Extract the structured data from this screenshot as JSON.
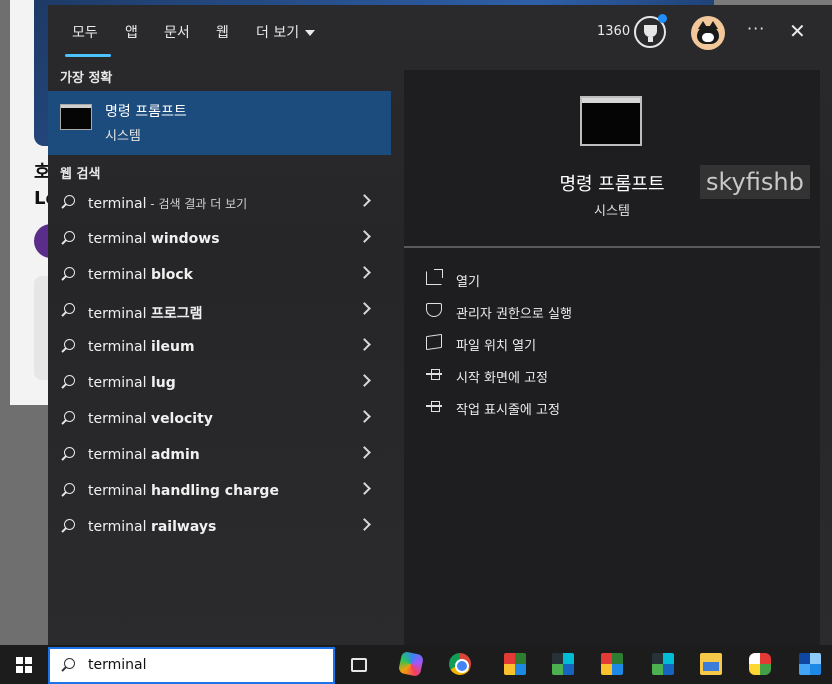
{
  "background": {
    "headline_line1": "호",
    "headline_line2": "Lo"
  },
  "tabs": [
    {
      "label": "모두"
    },
    {
      "label": "앱"
    },
    {
      "label": "문서"
    },
    {
      "label": "웹"
    },
    {
      "label": "더 보기"
    }
  ],
  "header": {
    "points": "1360",
    "more_label": "···",
    "close_label": "✕"
  },
  "best_match": {
    "section_label": "가장 정확",
    "name": "명령 프롬프트",
    "type": "시스템"
  },
  "web_search": {
    "section_label": "웹 검색",
    "items": [
      {
        "prefix": "terminal",
        "suffix": "",
        "hint": " - 검색 결과 더 보기"
      },
      {
        "prefix": "terminal ",
        "suffix": "windows",
        "hint": ""
      },
      {
        "prefix": "terminal ",
        "suffix": "block",
        "hint": ""
      },
      {
        "prefix": "terminal ",
        "suffix": "프로그램",
        "hint": ""
      },
      {
        "prefix": "terminal ",
        "suffix": "ileum",
        "hint": ""
      },
      {
        "prefix": "terminal ",
        "suffix": "lug",
        "hint": ""
      },
      {
        "prefix": "terminal ",
        "suffix": "velocity",
        "hint": ""
      },
      {
        "prefix": "terminal ",
        "suffix": "admin",
        "hint": ""
      },
      {
        "prefix": "terminal ",
        "suffix": "handling charge",
        "hint": ""
      },
      {
        "prefix": "terminal ",
        "suffix": "railways",
        "hint": ""
      }
    ]
  },
  "preview": {
    "name": "명령 프롬프트",
    "type": "시스템",
    "watermark": "skyfishb",
    "actions": [
      {
        "label": "열기",
        "icon": "open-icon"
      },
      {
        "label": "관리자 권한으로 실행",
        "icon": "shield-icon"
      },
      {
        "label": "파일 위치 열기",
        "icon": "folder-icon"
      },
      {
        "label": "시작 화면에 고정",
        "icon": "pin-icon"
      },
      {
        "label": "작업 표시줄에 고정",
        "icon": "pin-icon"
      }
    ]
  },
  "taskbar": {
    "search_value": "terminal"
  },
  "colors": {
    "accent": "#4cc2ff",
    "selected_bg": "#1b4c7d",
    "panel_bg": "#2a2a2c",
    "taskbar_bg": "#1c1c1c"
  }
}
